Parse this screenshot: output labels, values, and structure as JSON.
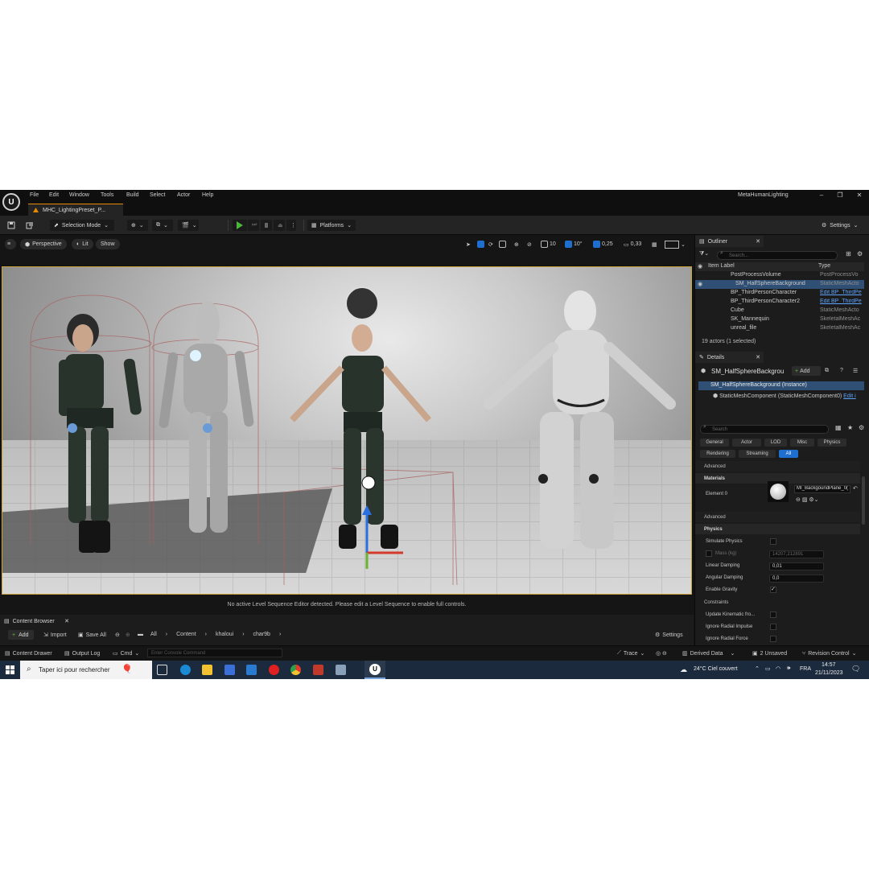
{
  "menu": [
    "File",
    "Edit",
    "Window",
    "Tools",
    "Build",
    "Select",
    "Actor",
    "Help"
  ],
  "project_name": "MetaHumanLighting",
  "map_tab": "MHC_LightingPreset_P...",
  "toolbar": {
    "selection_mode": "Selection Mode",
    "platforms": "Platforms",
    "settings": "Settings"
  },
  "viewport": {
    "perspective": "Perspective",
    "lit": "Lit",
    "show": "Show",
    "grid_snap": "10",
    "rot_snap": "10°",
    "scale_snap": "0,25",
    "cam_speed": "0,33",
    "status_message": "No active Level Sequence Editor detected. Please edit a Level Sequence to enable full controls."
  },
  "outliner": {
    "title": "Outliner",
    "search_placeholder": "Search...",
    "col_label": "Item Label",
    "col_type": "Type",
    "rows": [
      {
        "label": "PostProcessVolume",
        "type": "PostProcessVo"
      },
      {
        "label": "SM_HalfSphereBackground",
        "type": "StaticMeshActo"
      },
      {
        "label": "BP_ThirdPersonCharacter",
        "type": "Edit BP_ThirdPe"
      },
      {
        "label": "BP_ThirdPersonCharacter2",
        "type": "Edit BP_ThirdPe"
      },
      {
        "label": "Cube",
        "type": "StaticMeshActo"
      },
      {
        "label": "SK_Mannequin",
        "type": "SkeletalMeshAc"
      },
      {
        "label": "unreal_file",
        "type": "SkeletalMeshAc"
      }
    ],
    "footer": "19 actors (1 selected)"
  },
  "details": {
    "title": "Details",
    "actor_name": "SM_HalfSphereBackgrou",
    "add_label": "Add",
    "instance_label": "SM_HalfSphereBackground (Instance)",
    "component_label": "StaticMeshComponent (StaticMeshComponent0)",
    "component_edit": "Edit i",
    "search_placeholder": "Search",
    "filters_row1": [
      "General",
      "Actor",
      "LOD",
      "Misc",
      "Physics"
    ],
    "filters_row2": [
      "Rendering",
      "Streaming",
      "All"
    ],
    "advanced1": "Advanced",
    "materials_header": "Materials",
    "element0_label": "Element 0",
    "material_name": "MI_BackgoundPlane_0(",
    "advanced2": "Advanced",
    "physics_header": "Physics",
    "simulate_physics": "Simulate Physics",
    "mass_label": "Mass (kg)",
    "mass_value": "14207,212891",
    "linear_damping_label": "Linear Damping",
    "linear_damping_value": "0,01",
    "angular_damping_label": "Angular Damping",
    "angular_damping_value": "0,0",
    "enable_gravity": "Enable Gravity",
    "constraints": "Constraints",
    "update_kinematic": "Update Kinematic fro...",
    "ignore_radial_impulse": "Ignore Radial Impulse",
    "ignore_radial_force": "Ignore Radial Force"
  },
  "content_browser": {
    "title": "Content Browser",
    "add_label": "Add",
    "import_label": "Import",
    "save_all_label": "Save All",
    "path": [
      "All",
      "Content",
      "khaloui",
      "char9b"
    ],
    "settings": "Settings"
  },
  "bottom_bar": {
    "content_drawer": "Content Drawer",
    "output_log": "Output Log",
    "cmd": "Cmd",
    "console_placeholder": "Enter Console Command",
    "trace": "Trace",
    "derived_data": "Derived Data",
    "unsaved": "2 Unsaved",
    "revision_control": "Revision Control"
  },
  "taskbar": {
    "search_placeholder": "Taper ici pour rechercher",
    "weather": "24°C  Ciel couvert",
    "lang": "FRA",
    "time": "14:57",
    "date": "21/11/2023"
  }
}
